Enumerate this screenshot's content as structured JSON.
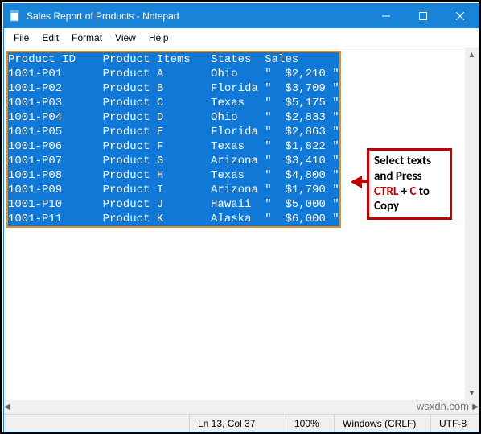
{
  "titlebar": {
    "title": "Sales Report of Products - Notepad"
  },
  "menu": {
    "file": "File",
    "edit": "Edit",
    "format": "Format",
    "view": "View",
    "help": "Help"
  },
  "editor": {
    "header": "Product ID    Product Items   States  Sales",
    "rows": [
      "1001-P01      Product A       Ohio    \"  $2,210 \"",
      "1001-P02      Product B       Florida \"  $3,709 \"",
      "1001-P03      Product C       Texas   \"  $5,175 \"",
      "1001-P04      Product D       Ohio    \"  $2,833 \"",
      "1001-P05      Product E       Florida \"  $2,863 \"",
      "1001-P06      Product F       Texas   \"  $1,822 \"",
      "1001-P07      Product G       Arizona \"  $3,410 \"",
      "1001-P08      Product H       Texas   \"  $4,800 \"",
      "1001-P09      Product I       Arizona \"  $1,790 \"",
      "1001-P10      Product J       Hawaii  \"  $5,000 \"",
      "1001-P11      Product K       Alaska  \"  $6,000 \""
    ]
  },
  "status": {
    "cursor": "Ln 13, Col 37",
    "zoom": "100%",
    "eol": "Windows (CRLF)",
    "encoding": "UTF-8"
  },
  "instruction": {
    "line1": "Select texts and Press ",
    "ctrl": "CTRL",
    "plus": " + ",
    "ckey": "C",
    "line2": " to Copy"
  },
  "watermark": "wsxdn.com"
}
